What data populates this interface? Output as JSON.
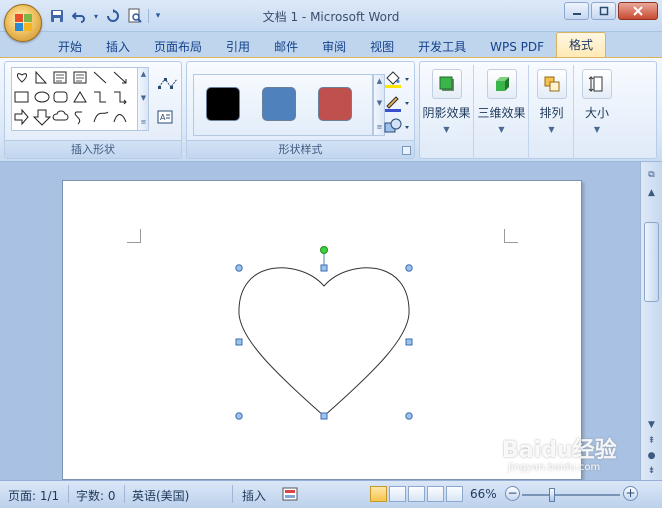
{
  "window": {
    "title": "文档 1 - Microsoft Word"
  },
  "tabs": [
    {
      "label": "开始",
      "active": false
    },
    {
      "label": "插入",
      "active": false
    },
    {
      "label": "页面布局",
      "active": false
    },
    {
      "label": "引用",
      "active": false
    },
    {
      "label": "邮件",
      "active": false
    },
    {
      "label": "审阅",
      "active": false
    },
    {
      "label": "视图",
      "active": false
    },
    {
      "label": "开发工具",
      "active": false
    },
    {
      "label": "WPS PDF",
      "active": false
    },
    {
      "label": "格式",
      "active": true
    }
  ],
  "ribbon": {
    "insert_shapes_label": "插入形状",
    "shape_styles_label": "形状样式",
    "style_swatches": [
      {
        "name": "black-style",
        "color": "#000000"
      },
      {
        "name": "blue-style",
        "color": "#4f81bd"
      },
      {
        "name": "red-style",
        "color": "#c0504d"
      }
    ],
    "shadow_label": "阴影效果",
    "threed_label": "三维效果",
    "arrange_label": "排列",
    "size_label": "大小"
  },
  "colors": {
    "accent_tab": "#ffe8b3",
    "selection_handle": "#4f81bd",
    "rotate_handle": "#3cd33c"
  },
  "statusbar": {
    "page": "页面: 1/1",
    "words": "字数: 0",
    "language": "英语(美国)",
    "mode": "插入",
    "zoom": "66%",
    "zoom_minus": "−",
    "zoom_plus": "+"
  },
  "watermark": {
    "brand": "Baidu经验",
    "url": "jingyan.baidu.com"
  }
}
